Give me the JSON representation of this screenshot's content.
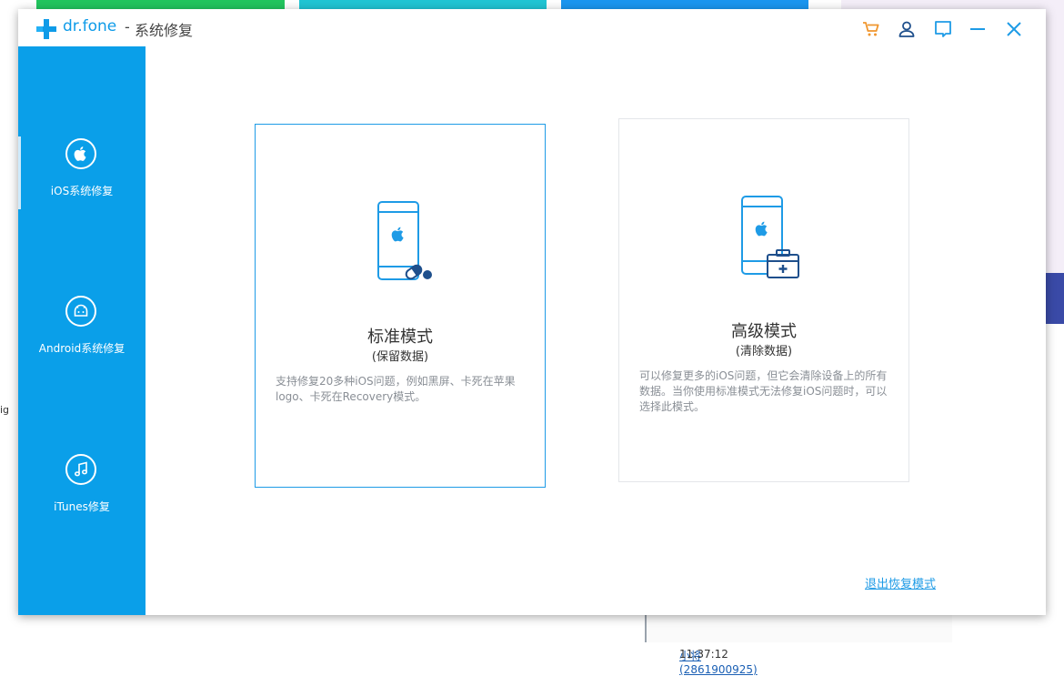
{
  "window": {
    "brand": "dr.fone",
    "separator": "-",
    "title": "系统修复"
  },
  "titlebar_icons": [
    "cart-icon",
    "user-icon",
    "feedback-icon",
    "minimize-icon",
    "close-icon"
  ],
  "sidebar": {
    "items": [
      {
        "label": "iOS系统修复",
        "icon": "apple-icon",
        "active": true
      },
      {
        "label": "Android系统修复",
        "icon": "android-icon",
        "active": false
      },
      {
        "label": "iTunes修复",
        "icon": "music-note-icon",
        "active": false
      }
    ]
  },
  "modes": {
    "standard": {
      "title": "标准模式",
      "subtitle": "(保留数据)",
      "description": "支持修复20多种iOS问题，例如黑屏、卡死在苹果logo、卡死在Recovery模式。"
    },
    "advanced": {
      "title": "高级模式",
      "subtitle": "(清除数据)",
      "description": "可以修复更多的iOS问题，但它会清除设备上的所有数据。当你使用标准模式无法修复iOS问题时，可以选择此模式。"
    }
  },
  "exit_link": "退出恢复模式",
  "background": {
    "fragment": "ig",
    "status_user": "小将(2861900925)",
    "status_time": "11:37:12"
  },
  "colors": {
    "accent": "#0a9fe9",
    "cart": "#f0962e",
    "icon_dark": "#1e4f8c"
  }
}
